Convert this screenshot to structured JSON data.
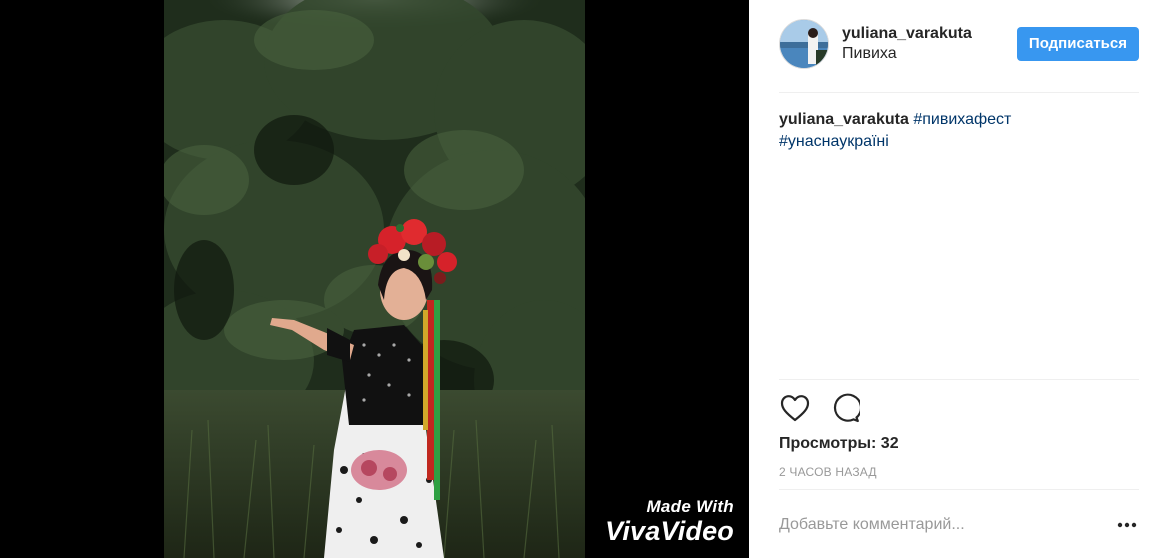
{
  "post": {
    "username": "yuliana_varakuta",
    "location": "Пивиха",
    "follow_label": "Подписаться",
    "caption": {
      "username": "yuliana_varakuta",
      "tag1": "#пивихафест",
      "tag2": "#унаснаукраїні"
    },
    "views_label": "Просмотры:",
    "views_count": "32",
    "timestamp": "2 ЧАСОВ НАЗАД",
    "comment_placeholder": "Добавьте комментарий..."
  },
  "media": {
    "watermark_line1": "Made With",
    "watermark_line2": "VivaVideo"
  },
  "icons": {
    "like": "heart-icon",
    "comment": "speech-bubble-icon",
    "more": "more-options-icon"
  },
  "colors": {
    "follow_button": "#3897f0",
    "hashtag": "#003569",
    "text": "#262626",
    "muted": "#999999",
    "divider": "#efefef",
    "media_background": "#000000"
  }
}
